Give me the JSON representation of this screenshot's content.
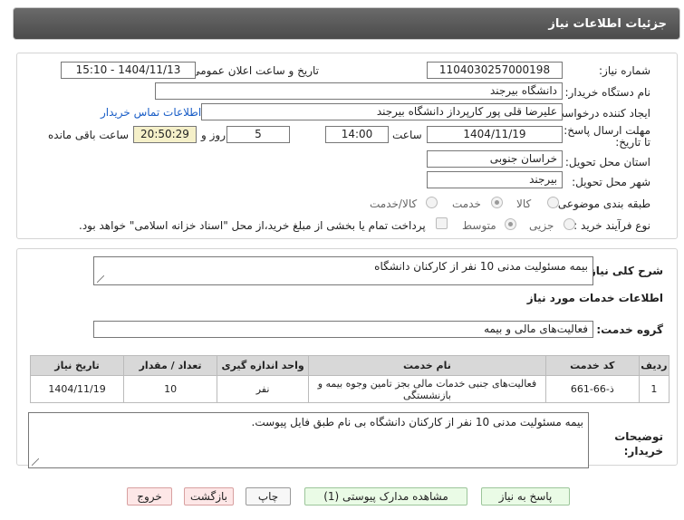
{
  "header": {
    "title": "جزئیات اطلاعات نیاز"
  },
  "form": {
    "need_number_label": "شماره نیاز:",
    "need_number": "1104030257000198",
    "announce_label": "تاریخ و ساعت اعلان عمومی:",
    "announce_value": "1404/11/13 - 15:10",
    "buyer_org_label": "نام دستگاه خریدار:",
    "buyer_org": "دانشگاه بیرجند",
    "creator_label": "ایجاد کننده درخواست:",
    "creator": "علیرضا قلی پور کارپرداز دانشگاه بیرجند",
    "contact_link": "اطلاعات تماس خریدار",
    "deadline_label": "مهلت ارسال پاسخ: تا تاریخ:",
    "deadline_date": "1404/11/19",
    "time_label": "ساعت",
    "deadline_time": "14:00",
    "days": "5",
    "days_label": "روز و",
    "remaining": "20:50:29",
    "remaining_label": "ساعت باقی مانده",
    "province_label": "استان محل تحویل:",
    "province": "خراسان جنوبی",
    "city_label": "شهر محل تحویل:",
    "city": "بیرجند",
    "category_label": "طبقه بندی موضوعی:",
    "category_options": [
      "کالا",
      "خدمت",
      "کالا/خدمت"
    ],
    "process_label": "نوع فرآیند خرید :",
    "process_options": [
      "جزیی",
      "متوسط"
    ],
    "payment_note": "پرداخت تمام یا بخشی از مبلغ خرید،از محل \"اسناد خزانه اسلامی\" خواهد بود."
  },
  "details": {
    "summary_label": "شرح کلی نیاز:",
    "summary": "بیمه مسئولیت مدنی 10 نفر از کارکنان دانشگاه",
    "services_heading": "اطلاعات خدمات مورد نیاز",
    "service_group_label": "گروه خدمت:",
    "service_group": "فعالیت‌های مالی و بیمه"
  },
  "table": {
    "headers": [
      "ردیف",
      "کد خدمت",
      "نام خدمت",
      "واحد اندازه گیری",
      "تعداد / مقدار",
      "تاریخ نیاز"
    ],
    "rows": [
      [
        "1",
        "ذ-66-661",
        "فعالیت‌های جنبی خدمات مالی بجز تامین وجوه بیمه و بازنشستگی",
        "نفر",
        "10",
        "1404/11/19"
      ]
    ]
  },
  "notes": {
    "label": "توضیحات خریدار:",
    "text": "بیمه مسئولیت مدنی 10 نفر از کارکنان دانشگاه بی نام طبق فایل پیوست."
  },
  "buttons": {
    "reply": "پاسخ به نیاز",
    "view_docs": "مشاهده مدارک پیوستی (1)",
    "print": "چاپ",
    "back": "بازگشت",
    "exit": "خروج"
  },
  "colors": {
    "header": "#555555",
    "link": "#1a5ec7",
    "watermark": "#e2e2e2"
  }
}
